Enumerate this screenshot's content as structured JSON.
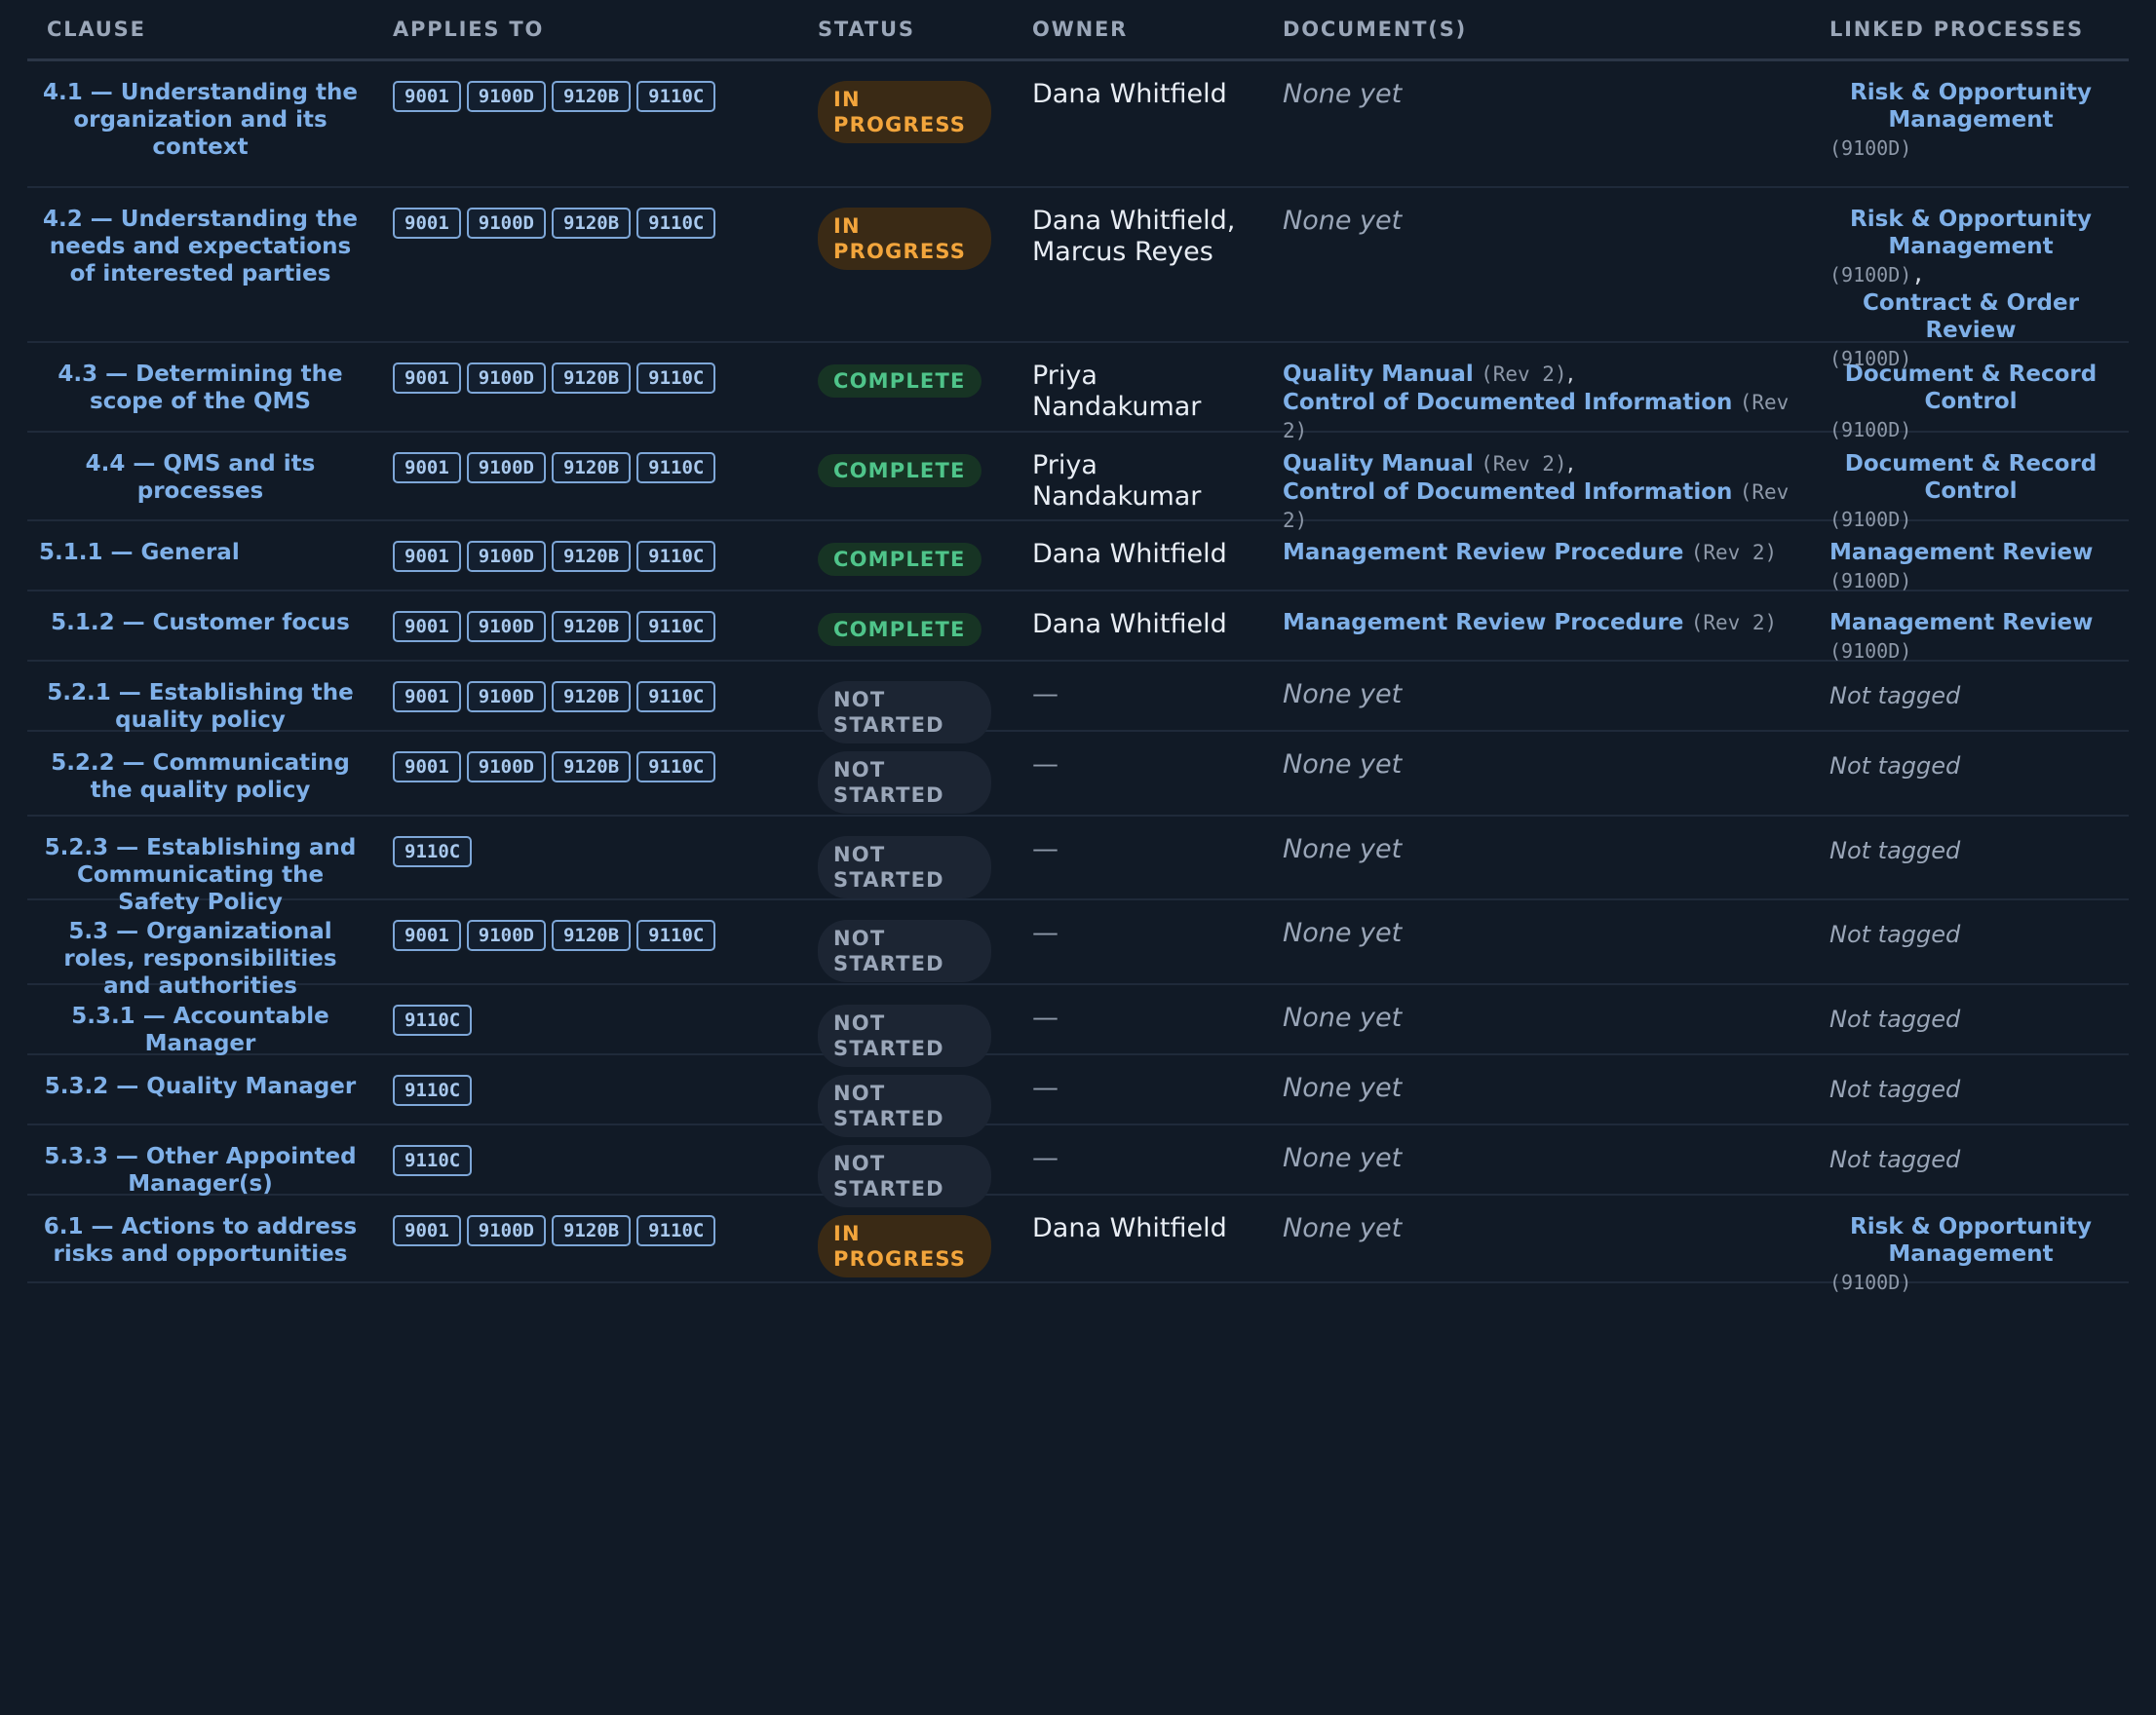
{
  "headers": {
    "clause": "CLAUSE",
    "applies_to": "APPLIES TO",
    "status": "STATUS",
    "owner": "OWNER",
    "documents": "DOCUMENT(S)",
    "linked_processes": "LINKED PROCESSES"
  },
  "colors": {
    "background": "#111a26",
    "link": "#7fb0e8",
    "in_progress": "#f2a53c",
    "complete": "#4fc48a",
    "not_started": "#9aa6b8"
  },
  "rows": [
    {
      "clause": "4.1 — Understanding the organization and its context",
      "tags": [
        "9001",
        "9100D",
        "9120B",
        "9110C"
      ],
      "status": "IN PROGRESS",
      "status_kind": "in_progress",
      "owner": "Dana Whitfield",
      "documents_text": "None yet",
      "documents": [],
      "processes": [
        {
          "name": "Risk & Opportunity Management",
          "tag": "(9100D)"
        }
      ],
      "processes_text": ""
    },
    {
      "clause": "4.2 — Understanding the needs and expectations of interested parties",
      "tags": [
        "9001",
        "9100D",
        "9120B",
        "9110C"
      ],
      "status": "IN PROGRESS",
      "status_kind": "in_progress",
      "owner": "Dana Whitfield, Marcus Reyes",
      "documents_text": "None yet",
      "documents": [],
      "processes": [
        {
          "name": "Risk & Opportunity Management",
          "tag": "(9100D)"
        },
        {
          "name": "Contract & Order Review",
          "tag": "(9100D)"
        }
      ],
      "processes_text": ""
    },
    {
      "clause": "4.3 — Determining the scope of the QMS",
      "tags": [
        "9001",
        "9100D",
        "9120B",
        "9110C"
      ],
      "status": "COMPLETE",
      "status_kind": "complete",
      "owner": "Priya Nandakumar",
      "documents_text": "",
      "documents": [
        {
          "name": "Quality Manual",
          "rev": "(Rev 2)"
        },
        {
          "name": "Control of Documented Information",
          "rev": "(Rev 2)"
        }
      ],
      "processes": [
        {
          "name": "Document & Record Control",
          "tag": "(9100D)"
        }
      ],
      "processes_text": ""
    },
    {
      "clause": "4.4 — QMS and its processes",
      "tags": [
        "9001",
        "9100D",
        "9120B",
        "9110C"
      ],
      "status": "COMPLETE",
      "status_kind": "complete",
      "owner": "Priya Nandakumar",
      "documents_text": "",
      "documents": [
        {
          "name": "Quality Manual",
          "rev": "(Rev 2)"
        },
        {
          "name": "Control of Documented Information",
          "rev": "(Rev 2)"
        }
      ],
      "processes": [
        {
          "name": "Document & Record Control",
          "tag": "(9100D)"
        }
      ],
      "processes_text": ""
    },
    {
      "clause": "5.1.1 — General",
      "tags": [
        "9001",
        "9100D",
        "9120B",
        "9110C"
      ],
      "status": "COMPLETE",
      "status_kind": "complete",
      "owner": "Dana Whitfield",
      "documents_text": "",
      "documents": [
        {
          "name": "Management Review Procedure",
          "rev": "(Rev 2)"
        }
      ],
      "processes": [
        {
          "name": "Management Review",
          "tag": "(9100D)"
        }
      ],
      "processes_text": ""
    },
    {
      "clause": "5.1.2 — Customer focus",
      "tags": [
        "9001",
        "9100D",
        "9120B",
        "9110C"
      ],
      "status": "COMPLETE",
      "status_kind": "complete",
      "owner": "Dana Whitfield",
      "documents_text": "",
      "documents": [
        {
          "name": "Management Review Procedure",
          "rev": "(Rev 2)"
        }
      ],
      "processes": [
        {
          "name": "Management Review",
          "tag": "(9100D)"
        }
      ],
      "processes_text": ""
    },
    {
      "clause": "5.2.1 — Establishing the quality policy",
      "tags": [
        "9001",
        "9100D",
        "9120B",
        "9110C"
      ],
      "status": "NOT STARTED",
      "status_kind": "not_started",
      "owner": "—",
      "documents_text": "None yet",
      "documents": [],
      "processes": [],
      "processes_text": "Not tagged"
    },
    {
      "clause": "5.2.2 — Communicating the quality policy",
      "tags": [
        "9001",
        "9100D",
        "9120B",
        "9110C"
      ],
      "status": "NOT STARTED",
      "status_kind": "not_started",
      "owner": "—",
      "documents_text": "None yet",
      "documents": [],
      "processes": [],
      "processes_text": "Not tagged"
    },
    {
      "clause": "5.2.3 — Establishing and Communicating the Safety Policy",
      "tags": [
        "9110C"
      ],
      "status": "NOT STARTED",
      "status_kind": "not_started",
      "owner": "—",
      "documents_text": "None yet",
      "documents": [],
      "processes": [],
      "processes_text": "Not tagged"
    },
    {
      "clause": "5.3 — Organizational roles, responsibilities and authorities",
      "tags": [
        "9001",
        "9100D",
        "9120B",
        "9110C"
      ],
      "status": "NOT STARTED",
      "status_kind": "not_started",
      "owner": "—",
      "documents_text": "None yet",
      "documents": [],
      "processes": [],
      "processes_text": "Not tagged"
    },
    {
      "clause": "5.3.1 — Accountable Manager",
      "tags": [
        "9110C"
      ],
      "status": "NOT STARTED",
      "status_kind": "not_started",
      "owner": "—",
      "documents_text": "None yet",
      "documents": [],
      "processes": [],
      "processes_text": "Not tagged"
    },
    {
      "clause": "5.3.2 — Quality Manager",
      "tags": [
        "9110C"
      ],
      "status": "NOT STARTED",
      "status_kind": "not_started",
      "owner": "—",
      "documents_text": "None yet",
      "documents": [],
      "processes": [],
      "processes_text": "Not tagged"
    },
    {
      "clause": "5.3.3 — Other Appointed Manager(s)",
      "tags": [
        "9110C"
      ],
      "status": "NOT STARTED",
      "status_kind": "not_started",
      "owner": "—",
      "documents_text": "None yet",
      "documents": [],
      "processes": [],
      "processes_text": "Not tagged"
    },
    {
      "clause": "6.1 — Actions to address risks and opportunities",
      "tags": [
        "9001",
        "9100D",
        "9120B",
        "9110C"
      ],
      "status": "IN PROGRESS",
      "status_kind": "in_progress",
      "owner": "Dana Whitfield",
      "documents_text": "None yet",
      "documents": [],
      "processes": [
        {
          "name": "Risk & Opportunity Management",
          "tag": "(9100D)"
        }
      ],
      "processes_text": ""
    }
  ]
}
